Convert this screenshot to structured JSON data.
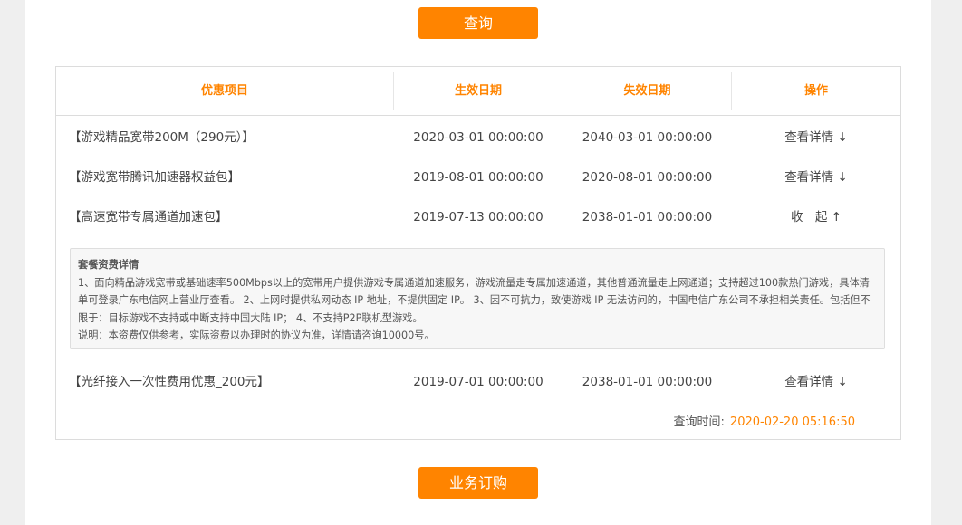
{
  "buttons": {
    "query": "查询",
    "order": "业务订购"
  },
  "table": {
    "headers": [
      "优惠项目",
      "生效日期",
      "失效日期",
      "操作"
    ],
    "rows": [
      {
        "name": "【游戏精品宽带200M（290元）】",
        "start": "2020-03-01 00:00:00",
        "end": "2040-03-01 00:00:00",
        "action": "查看详情 ↓"
      },
      {
        "name": "【游戏宽带腾讯加速器权益包】",
        "start": "2019-08-01 00:00:00",
        "end": "2020-08-01 00:00:00",
        "action": "查看详情 ↓"
      },
      {
        "name": "【高速宽带专属通道加速包】",
        "start": "2019-07-13 00:00:00",
        "end": "2038-01-01 00:00:00",
        "action": "收　起 ↑"
      },
      {
        "name": "【光纤接入一次性费用优惠_200元】",
        "start": "2019-07-01 00:00:00",
        "end": "2038-01-01 00:00:00",
        "action": "查看详情 ↓"
      }
    ]
  },
  "detail": {
    "title": "套餐资费详情",
    "body": "1、面向精品游戏宽带或基础速率500Mbps以上的宽带用户提供游戏专属通道加速服务，游戏流量走专属加速通道，其他普通流量走上网通道；支持超过100款热门游戏，具体清单可登录广东电信网上营业厅查看。 2、上网时提供私网动态 IP 地址，不提供固定 IP。 3、因不可抗力，致使游戏 IP 无法访问的，中国电信广东公司不承担相关责任。包括但不限于：目标游戏不支持或中断支持中国大陆 IP； 4、不支持P2P联机型游戏。",
    "note": "说明：本资费仅供参考，实际资费以办理时的协议为准，详情请咨询10000号。"
  },
  "query_time": {
    "label": "查询时间:",
    "value": "2020-02-20 05:16:50"
  },
  "colors": {
    "accent": "#ff8400",
    "border": "#dcdcdc"
  }
}
